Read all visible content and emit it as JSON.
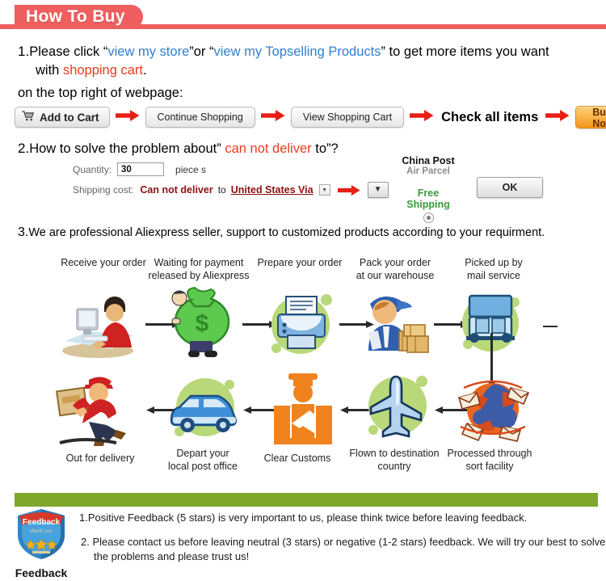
{
  "header": {
    "title": "How To Buy",
    "tab_color": "#ef5f5f",
    "rule_color": "#ef5f5f"
  },
  "step1": {
    "number": "1.",
    "t1": "Please click ",
    "q1open": "“",
    "link1": "view my store",
    "q1close": "”",
    "t2": "or ",
    "q2open": "“",
    "link2": "view my Topselling Products",
    "q2close": "”",
    "t3": " to get  more items you want",
    "t4": "with ",
    "highlight": "shopping cart",
    "t5": ".",
    "subtitle": "on the top right of webpage:"
  },
  "buttons": {
    "add_to_cart": "Add to Cart",
    "cart_icon": "shopping-cart-icon",
    "continue_shopping": "Continue Shopping",
    "view_shopping_cart": "View Shopping Cart",
    "check_all_items": "Check all items",
    "buy_now": "Buy Now",
    "buy_now_color": "#f3971b",
    "arrow_color": "#e81f16"
  },
  "step2": {
    "number": "2.",
    "t1": "How to solve the problem about” ",
    "highlight": "can not deliver",
    "t2": " to”?"
  },
  "form": {
    "quantity_label": "Quantity:",
    "quantity_value": "30",
    "quantity_unit": "piece s",
    "shipping_label": "Shipping cost:",
    "shipping_value": "Can not deliver",
    "shipping_to": "to",
    "shipping_country": "United States Via",
    "mini_dropdown_icon": "chevron-down-icon",
    "big_dropdown_icon": "chevron-down-icon"
  },
  "shipping_option": {
    "carrier": "China Post",
    "carrier_sub": "Air Parcel",
    "free_line1": "Free",
    "free_line2": "Shipping",
    "free_color": "#3a9a3a",
    "radio_icon": "radio-selected-icon",
    "ok_button": "OK"
  },
  "step3": {
    "number": "3.",
    "text": "We are professional Aliexpress seller, support to customized products according to your requirment."
  },
  "flow": {
    "row1": [
      {
        "label": "Receive your order",
        "icon": "person-at-computer-icon"
      },
      {
        "label": "Waiting for payment\nreleased by Aliexpress",
        "icon": "money-bag-icon"
      },
      {
        "label": "Prepare your order",
        "icon": "printer-icon"
      },
      {
        "label": "Pack your order\nat our warehouse",
        "icon": "warehouse-worker-icon"
      },
      {
        "label": "Picked up by\nmail service",
        "icon": "mail-truck-icon"
      }
    ],
    "row2": [
      {
        "label": "Out for delivery",
        "icon": "delivery-courier-icon"
      },
      {
        "label": "Depart your\nlocal post office",
        "icon": "postal-van-icon"
      },
      {
        "label": "Clear Customs",
        "icon": "customs-officer-icon"
      },
      {
        "label": "Flown to destination\ncountry",
        "icon": "airplane-icon"
      },
      {
        "label": "Processed through\nsort facility",
        "icon": "globe-mail-icon"
      }
    ],
    "blob_color": "#b9d87a",
    "arrow_color": "#2b2b2b"
  },
  "feedback": {
    "bar_color": "#7fa72b",
    "badge_icon": "feedback-shield-badge-icon",
    "badge_banner": "Feedback",
    "badge_script": "thank you",
    "badge_caption": "Feedback",
    "line1": "1.Positive Feedback (5 stars) is very important to us, please think twice before leaving feedback.",
    "line2": "2. Please contact us before leaving neutral (3 stars) or negative (1-2 stars) feedback. We will try our best to solve",
    "line3": "the problems and please trust us!"
  }
}
